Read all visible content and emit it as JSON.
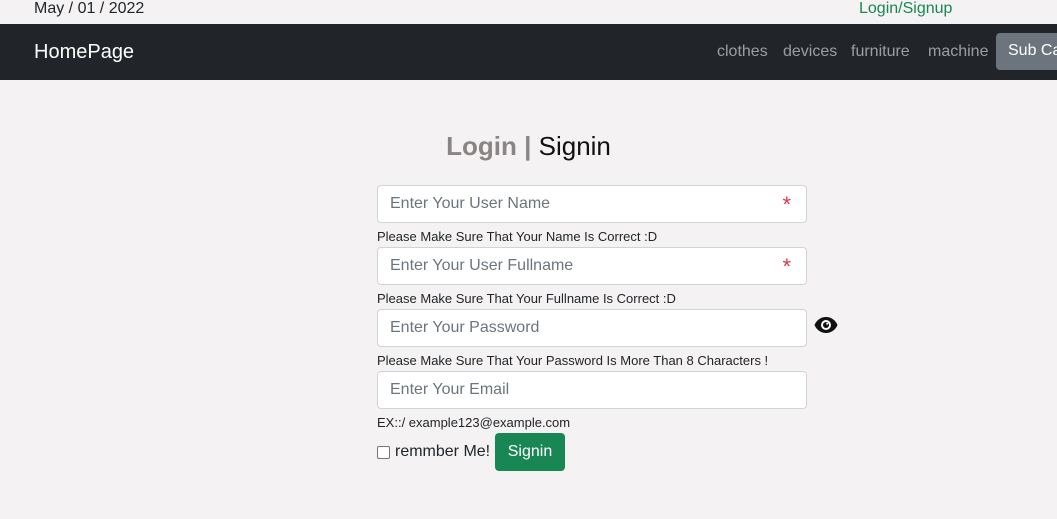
{
  "topbar": {
    "date": "May / 01 / 2022",
    "login_link": "Login/Signup"
  },
  "navbar": {
    "brand": "HomePage",
    "links": [
      "clothes",
      "devices",
      "furniture",
      "machine"
    ],
    "sub_button": "Sub Ca"
  },
  "form": {
    "title_login": "Login",
    "title_sep": "|",
    "title_signin": "Signin",
    "username": {
      "placeholder": "Enter Your User Name",
      "value": "",
      "required_mark": "*"
    },
    "username_hint": "Please Make Sure That Your Name Is Correct :D",
    "fullname": {
      "placeholder": "Enter Your User Fullname",
      "value": "",
      "required_mark": "*"
    },
    "fullname_hint": "Please Make Sure That Your Fullname Is Correct :D",
    "password": {
      "placeholder": "Enter Your Password",
      "value": ""
    },
    "password_hint": "Please Make Sure That Your Password Is More Than 8 Characters !",
    "email": {
      "placeholder": "Enter Your Email",
      "value": ""
    },
    "email_hint": "EX::/ example123@example.com",
    "remember_label": "remmber Me!",
    "remember_checked": false,
    "submit_label": "Signin"
  },
  "icons": {
    "password_toggle": "eye-icon"
  },
  "colors": {
    "page_bg": "#f4f2f2",
    "navbar_bg": "#212529",
    "accent_green": "#198754",
    "required_red": "#dc3545",
    "sub_button_bg": "#6c757d"
  }
}
